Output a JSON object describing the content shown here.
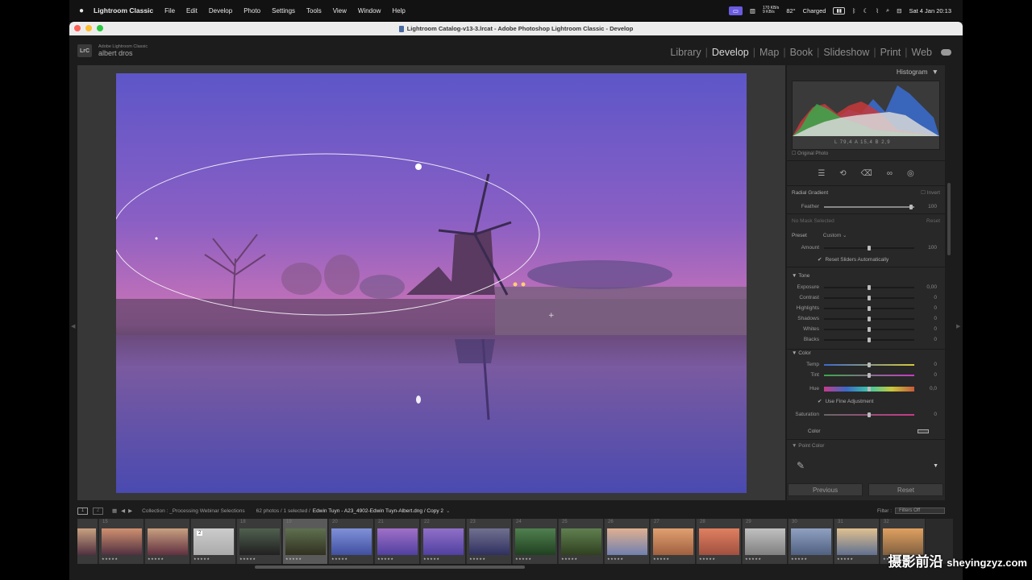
{
  "menubar": {
    "app_name": "Lightroom Classic",
    "items": [
      "File",
      "Edit",
      "Develop",
      "Photo",
      "Settings",
      "Tools",
      "View",
      "Window",
      "Help"
    ],
    "net_speed": "170 KB/s\n9 KB/s",
    "temperature": "82°",
    "battery": "Charged",
    "datetime": "Sat 4 Jan  20:13"
  },
  "window": {
    "title": "Lightroom Catalog-v13-3.lrcat - Adobe Photoshop Lightroom Classic - Develop"
  },
  "identity": {
    "logo": "LrC",
    "product": "Adobe Lightroom Classic",
    "user": "albert dros"
  },
  "modules": [
    "Library",
    "Develop",
    "Map",
    "Book",
    "Slideshow",
    "Print",
    "Web"
  ],
  "active_module": "Develop",
  "right_panel": {
    "histogram_label": "Histogram",
    "readout": {
      "l": "L",
      "l_val": "79,4",
      "a": "A",
      "a_val": "15,4",
      "b": "B",
      "b_val": "2,9"
    },
    "original_photo": "Original Photo",
    "mask": {
      "title": "Radial Gradient",
      "invert": "Invert",
      "feather_label": "Feather",
      "feather_value": "100",
      "feather_fraction": 0.96,
      "no_mask": "No Mask Selected",
      "reset": "Reset",
      "preset_label": "Preset",
      "preset_value": "Custom",
      "amount_label": "Amount",
      "amount_value": "100",
      "reset_sliders": "Reset Sliders Automatically"
    },
    "tone": {
      "title": "Tone",
      "sliders": [
        {
          "label": "Exposure",
          "value": "0,00"
        },
        {
          "label": "Contrast",
          "value": "0"
        },
        {
          "label": "Highlights",
          "value": "0"
        },
        {
          "label": "Shadows",
          "value": "0"
        },
        {
          "label": "Whites",
          "value": "0"
        },
        {
          "label": "Blacks",
          "value": "0"
        }
      ]
    },
    "color": {
      "title": "Color",
      "temp_label": "Temp",
      "temp_value": "0",
      "tint_label": "Tint",
      "tint_value": "0",
      "hue_label": "Hue",
      "hue_value": "0,0",
      "fine_adjust": "Use Fine Adjustment",
      "sat_label": "Saturation",
      "sat_value": "0",
      "color_label": "Color"
    },
    "point_color": "Point Color",
    "previous": "Previous",
    "reset_btn": "Reset"
  },
  "filmstrip": {
    "view1": "1",
    "view2": "2",
    "collection_label": "Collection : _Processing Webinar Selections",
    "count": "62 photos / 1 selected /",
    "file": "Edwin Tuyn - A23_4902-Edwin Tuyn-Albert.dng / Copy 2",
    "filter_label": "Filter :",
    "filter_value": "Filters Off",
    "frames": [
      "14",
      "15",
      "",
      "",
      "18",
      "19",
      "20",
      "21",
      "22",
      "23",
      "24",
      "25",
      "26",
      "27",
      "28",
      "29",
      "30",
      "31",
      "32"
    ],
    "selected_index": 5,
    "thumbnail_badge": "2"
  },
  "watermark": {
    "cn": "摄影前沿",
    "url": "sheyingzyz.com"
  },
  "colors": {
    "accent": "#6b5be0",
    "panel": "#282828",
    "workspace": "#373737"
  }
}
